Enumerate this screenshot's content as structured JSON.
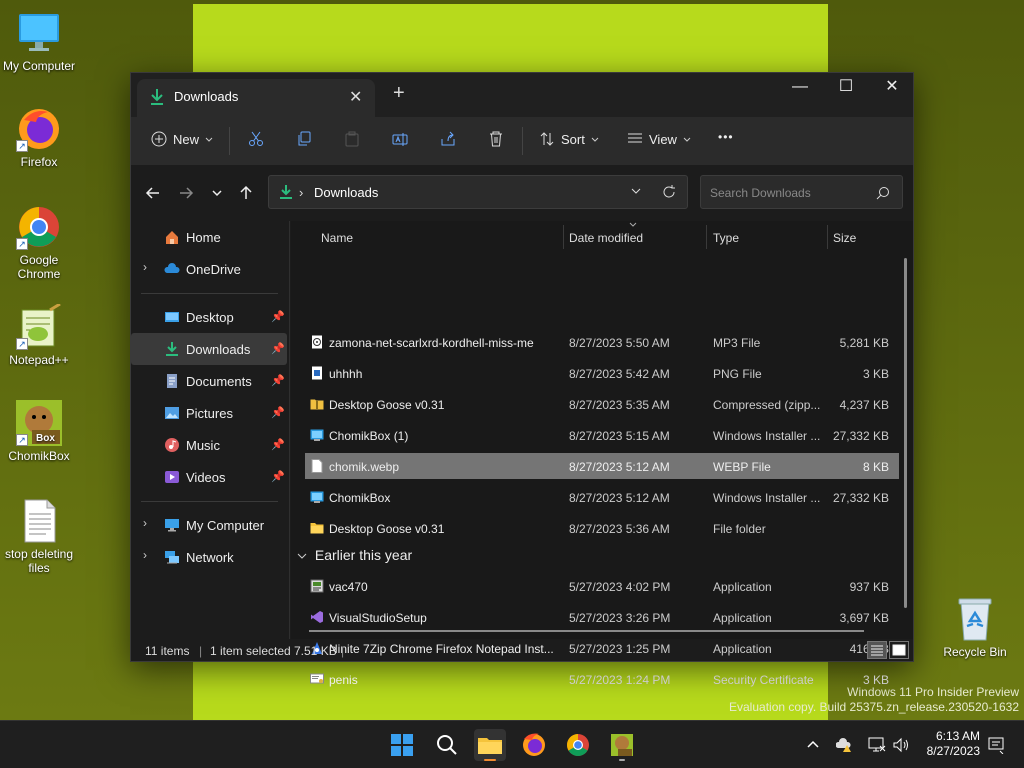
{
  "desktop": {
    "icons": [
      {
        "label": "My Computer"
      },
      {
        "label": "Firefox"
      },
      {
        "label": "Google Chrome"
      },
      {
        "label": "Notepad++"
      },
      {
        "label": "ChomikBox"
      },
      {
        "label": "stop deleting files"
      },
      {
        "label": "Recycle Bin"
      }
    ],
    "watermark_line1": "Windows 11 Pro Insider Preview",
    "watermark_line2": "Evaluation copy. Build 25375.zn_release.230520-1632"
  },
  "window": {
    "tab_title": "Downloads",
    "tab_close": "✕",
    "new_tab": "+",
    "controls": {
      "minimize": "—",
      "maximize": "☐",
      "close": "✕"
    }
  },
  "toolbar": {
    "new_label": "New",
    "sort_label": "Sort",
    "view_label": "View",
    "more_label": "•••"
  },
  "address": {
    "crumb_separator": "›",
    "location": "Downloads",
    "search_placeholder": "Search Downloads"
  },
  "sidebar": {
    "home": "Home",
    "onedrive": "OneDrive",
    "quick": [
      {
        "label": "Desktop",
        "color": "#3aa0e8"
      },
      {
        "label": "Downloads",
        "color": "#2bbd7e"
      },
      {
        "label": "Documents",
        "color": "#8aa0c8"
      },
      {
        "label": "Pictures",
        "color": "#4f9ee3"
      },
      {
        "label": "Music",
        "color": "#e06060"
      },
      {
        "label": "Videos",
        "color": "#8a5ad6"
      }
    ],
    "my_computer": "My Computer",
    "network": "Network",
    "pin_icon": "📌"
  },
  "columns": {
    "name": "Name",
    "date": "Date modified",
    "type": "Type",
    "size": "Size"
  },
  "files": [
    {
      "name": "zamona-net-scarlxrd-kordhell-miss-me",
      "date": "8/27/2023 5:50 AM",
      "type": "MP3 File",
      "size": "5,281 KB",
      "icon": "audio-file-icon"
    },
    {
      "name": "uhhhh",
      "date": "8/27/2023 5:42 AM",
      "type": "PNG File",
      "size": "3 KB",
      "icon": "image-file-icon"
    },
    {
      "name": "Desktop Goose v0.31",
      "date": "8/27/2023 5:35 AM",
      "type": "Compressed (zipp...",
      "size": "4,237 KB",
      "icon": "zip-folder-icon"
    },
    {
      "name": "ChomikBox (1)",
      "date": "8/27/2023 5:15 AM",
      "type": "Windows Installer ...",
      "size": "27,332 KB",
      "icon": "installer-icon"
    },
    {
      "name": "chomik.webp",
      "date": "8/27/2023 5:12 AM",
      "type": "WEBP File",
      "size": "8 KB",
      "icon": "blank-file-icon"
    },
    {
      "name": "ChomikBox",
      "date": "8/27/2023 5:12 AM",
      "type": "Windows Installer ...",
      "size": "27,332 KB",
      "icon": "installer-icon"
    },
    {
      "name": "Desktop Goose v0.31",
      "date": "8/27/2023 5:36 AM",
      "type": "File folder",
      "size": "",
      "icon": "folder-icon"
    }
  ],
  "group_label": "Earlier this year",
  "files_earlier": [
    {
      "name": "vac470",
      "date": "5/27/2023 4:02 PM",
      "type": "Application",
      "size": "937 KB",
      "icon": "app-icon"
    },
    {
      "name": "VisualStudioSetup",
      "date": "5/27/2023 3:26 PM",
      "type": "Application",
      "size": "3,697 KB",
      "icon": "visual-studio-icon"
    },
    {
      "name": "Ninite 7Zip Chrome Firefox Notepad Inst...",
      "date": "5/27/2023 1:25 PM",
      "type": "Application",
      "size": "416 KB",
      "icon": "ninite-icon"
    },
    {
      "name": "penis",
      "date": "5/27/2023 1:24 PM",
      "type": "Security Certificate",
      "size": "3 KB",
      "icon": "certificate-icon"
    }
  ],
  "status": {
    "items": "11 items",
    "selected": "1 item selected",
    "size": "7.51 KB"
  },
  "clock": {
    "time": "6:13 AM",
    "date": "8/27/2023"
  },
  "colors": {
    "accent": "#2bbd7e",
    "wallpaper": "#b7da1c",
    "selection": "#757575"
  }
}
